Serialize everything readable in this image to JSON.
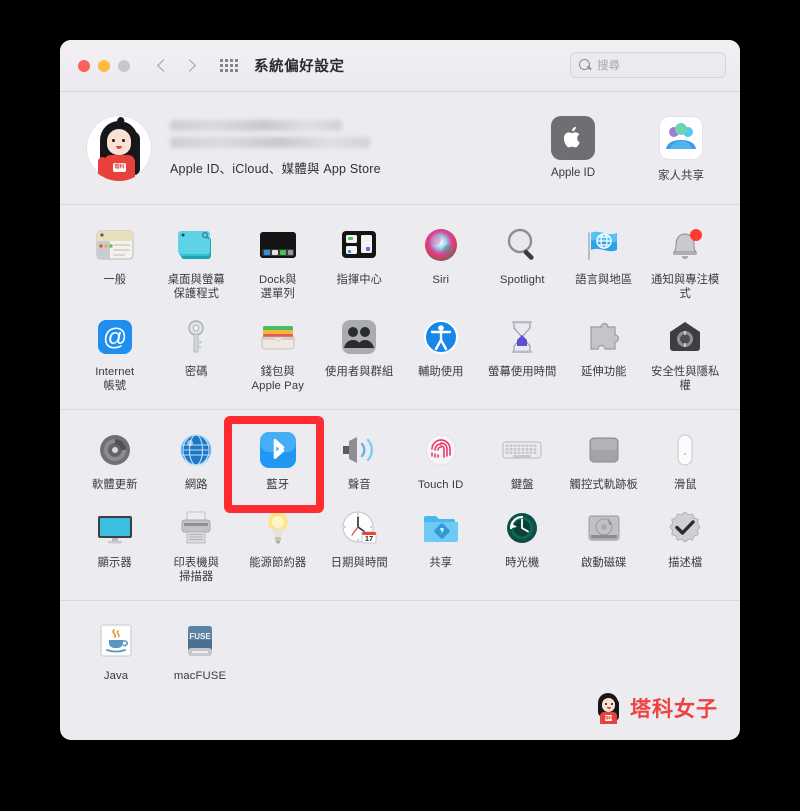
{
  "window": {
    "title": "系統偏好設定",
    "search": {
      "placeholder": "搜尋",
      "icon": "search-icon"
    },
    "traffic_lights": [
      "close-red",
      "minimize-yellow",
      "zoom-gray"
    ],
    "nav": {
      "back": "chevron-left-icon",
      "forward": "chevron-right-icon",
      "grid": "grid-view-icon"
    }
  },
  "apple_id": {
    "name_hidden": "",
    "subtitle": "Apple ID、iCloud、媒體與 App Store",
    "avatar_badge": "理科",
    "tiles": [
      {
        "label": "Apple ID",
        "icon": "apple-logo-icon"
      },
      {
        "label": "家人共享",
        "icon": "family-sharing-icon"
      }
    ]
  },
  "highlight": {
    "target_label": "藍牙",
    "color": "#fe2b31",
    "border_width": 8
  },
  "sections": [
    {
      "id": "personal",
      "rows": [
        [
          {
            "label": "一般",
            "icon": "general-icon"
          },
          {
            "label": "桌面與螢幕\n保護程式",
            "icon": "desktop-screensaver-icon"
          },
          {
            "label": "Dock與\n選單列",
            "icon": "dock-menubar-icon"
          },
          {
            "label": "指揮中心",
            "icon": "mission-control-icon"
          },
          {
            "label": "Siri",
            "icon": "siri-icon"
          },
          {
            "label": "Spotlight",
            "icon": "spotlight-icon"
          },
          {
            "label": "語言與地區",
            "icon": "language-region-icon"
          },
          {
            "label": "通知與專注模式",
            "icon": "notifications-focus-icon"
          }
        ],
        [
          {
            "label": "Internet\n帳號",
            "icon": "internet-accounts-icon"
          },
          {
            "label": "密碼",
            "icon": "passwords-key-icon"
          },
          {
            "label": "錢包與\nApple Pay",
            "icon": "wallet-applepay-icon"
          },
          {
            "label": "使用者與群組",
            "icon": "users-groups-icon"
          },
          {
            "label": "輔助使用",
            "icon": "accessibility-icon"
          },
          {
            "label": "螢幕使用時間",
            "icon": "screen-time-icon"
          },
          {
            "label": "延伸功能",
            "icon": "extensions-puzzle-icon"
          },
          {
            "label": "安全性與隱私權",
            "icon": "security-privacy-icon"
          }
        ]
      ]
    },
    {
      "id": "hardware",
      "rows": [
        [
          {
            "label": "軟體更新",
            "icon": "software-update-icon"
          },
          {
            "label": "網路",
            "icon": "network-globe-icon"
          },
          {
            "label": "藍牙",
            "icon": "bluetooth-icon"
          },
          {
            "label": "聲音",
            "icon": "sound-speaker-icon"
          },
          {
            "label": "Touch ID",
            "icon": "touch-id-icon"
          },
          {
            "label": "鍵盤",
            "icon": "keyboard-icon"
          },
          {
            "label": "觸控式軌跡板",
            "icon": "trackpad-icon"
          },
          {
            "label": "滑鼠",
            "icon": "mouse-icon"
          }
        ],
        [
          {
            "label": "顯示器",
            "icon": "displays-icon"
          },
          {
            "label": "印表機與\n掃描器",
            "icon": "printers-scanners-icon"
          },
          {
            "label": "能源節約器",
            "icon": "energy-saver-bulb-icon"
          },
          {
            "label": "日期與時間",
            "icon": "date-time-clock-icon"
          },
          {
            "label": "共享",
            "icon": "sharing-folder-icon"
          },
          {
            "label": "時光機",
            "icon": "time-machine-icon"
          },
          {
            "label": "啟動磁碟",
            "icon": "startup-disk-icon"
          },
          {
            "label": "描述檔",
            "icon": "profiles-badge-icon"
          }
        ]
      ]
    },
    {
      "id": "third-party",
      "rows": [
        [
          {
            "label": "Java",
            "icon": "java-icon"
          },
          {
            "label": "macFUSE",
            "icon": "macfuse-icon"
          }
        ]
      ]
    }
  ],
  "watermark": {
    "text": "塔科女子",
    "badge": "理科",
    "color": "#ef4141"
  },
  "date_icon": {
    "day": "17"
  },
  "fuse_icon": {
    "text": "FUSE"
  }
}
